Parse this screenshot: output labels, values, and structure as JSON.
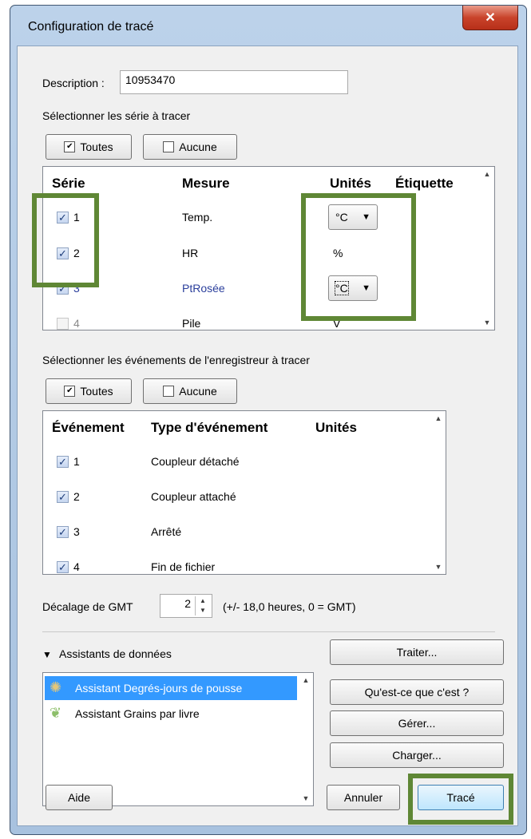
{
  "window": {
    "title": "Configuration de tracé"
  },
  "description": {
    "label": "Description :",
    "value": "10953470"
  },
  "series_section": {
    "heading": "Sélectionner les série à tracer",
    "all_button": "Toutes",
    "none_button": "Aucune",
    "columns": [
      "Série",
      "Mesure",
      "Unités",
      "Étiquette"
    ],
    "rows": [
      {
        "id": "1",
        "measure": "Temp.",
        "unit": "°C",
        "unit_is_combo": true,
        "checked": true
      },
      {
        "id": "2",
        "measure": "HR",
        "unit": "%",
        "unit_is_combo": false,
        "checked": true
      },
      {
        "id": "3",
        "measure": "PtRosée",
        "unit": "°C",
        "unit_is_combo": true,
        "checked": true
      },
      {
        "id": "4",
        "measure": "Pile",
        "unit": "V",
        "unit_is_combo": false,
        "checked": false
      }
    ]
  },
  "events_section": {
    "heading": "Sélectionner les événements de l'enregistreur à tracer",
    "all_button": "Toutes",
    "none_button": "Aucune",
    "columns": [
      "Événement",
      "Type d'événement",
      "Unités"
    ],
    "rows": [
      {
        "id": "1",
        "type": "Coupleur détaché",
        "checked": true
      },
      {
        "id": "2",
        "type": "Coupleur attaché",
        "checked": true
      },
      {
        "id": "3",
        "type": "Arrêté",
        "checked": true
      },
      {
        "id": "4",
        "type": "Fin de fichier",
        "checked": true
      }
    ]
  },
  "gmt": {
    "label": "Décalage de GMT",
    "value": "2",
    "hint": "(+/- 18,0 heures, 0 = GMT)"
  },
  "assistants": {
    "heading": "Assistants de données",
    "items": [
      "Assistant Degrés-jours de pousse",
      "Assistant Grains par livre"
    ],
    "buttons": {
      "process": "Traiter...",
      "what": "Qu'est-ce que c'est ?",
      "manage": "Gérer...",
      "load": "Charger..."
    }
  },
  "footer": {
    "help": "Aide",
    "cancel": "Annuler",
    "plot": "Tracé"
  },
  "colors": {
    "highlight": "#5f8735",
    "selection": "#3399ff",
    "link_text": "#2b3f9c"
  }
}
